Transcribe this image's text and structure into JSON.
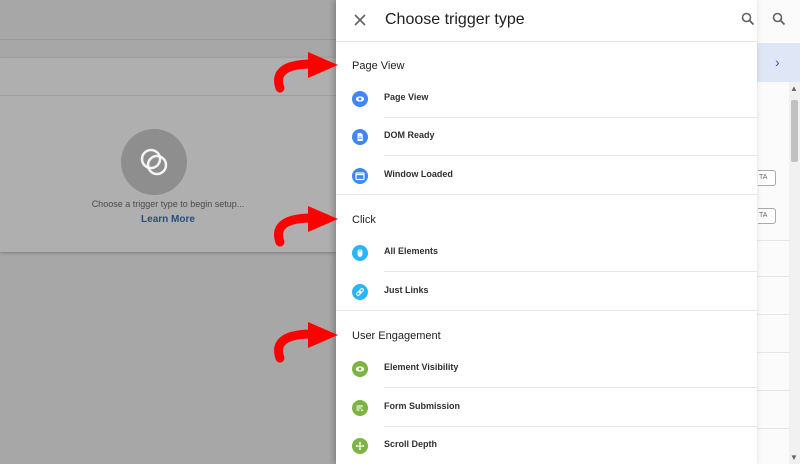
{
  "panel": {
    "title": "Choose trigger type"
  },
  "background": {
    "empty_state_text": "Choose a trigger type to begin setup...",
    "learn_more_link": "Learn More",
    "rail_button_label": "TA"
  },
  "sections": [
    {
      "title": "Page View",
      "items": [
        {
          "label": "Page View",
          "icon": "eye-icon"
        },
        {
          "label": "DOM Ready",
          "icon": "document-icon"
        },
        {
          "label": "Window Loaded",
          "icon": "window-icon"
        }
      ]
    },
    {
      "title": "Click",
      "items": [
        {
          "label": "All Elements",
          "icon": "mouse-icon"
        },
        {
          "label": "Just Links",
          "icon": "link-icon"
        }
      ]
    },
    {
      "title": "User Engagement",
      "items": [
        {
          "label": "Element Visibility",
          "icon": "eye-icon"
        },
        {
          "label": "Form Submission",
          "icon": "form-icon"
        },
        {
          "label": "Scroll Depth",
          "icon": "move-icon"
        }
      ]
    }
  ],
  "colors": {
    "page_view": "#4285f4",
    "click": "#29b6f6",
    "user_engagement": "#7cb342",
    "annotation_arrow": "#ff0000"
  }
}
